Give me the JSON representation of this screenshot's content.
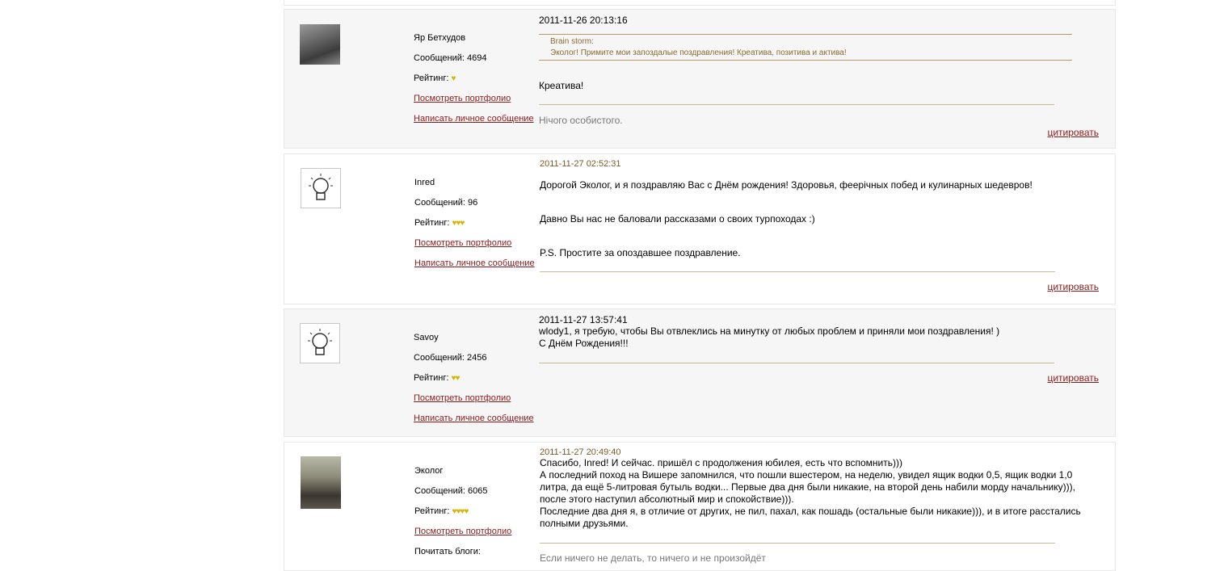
{
  "labels": {
    "messages_prefix": "Сообщений: ",
    "rating": "Рейтинг:",
    "portfolio_link": "Посмотреть портфолио",
    "pm_link": "Написать личное сообщение",
    "cite": "цитировать",
    "blogs": "Почитать блоги:"
  },
  "posts": [
    {
      "author": "Яр Бетхудов",
      "messages": "Сообщений: 4694",
      "rating_icons": "♥",
      "date": "2011-11-26 20:13:16",
      "quote_author": "Brain storm:",
      "quote_text": "Эколог! Примите мои запоздалые поздравления! Креатива, позитива и актива!",
      "body": [
        "Креатива!"
      ],
      "signature": "Нічого особистого."
    },
    {
      "author": "Inred",
      "messages": "Сообщений: 96",
      "rating_icons": "♥♥♥",
      "date": "2011-11-27 02:52:31",
      "body": [
        "Дорогой Эколог, и я поздравляю Вас с Днём рождения! Здоровья, феерічных побед и кулинарных шедевров!",
        "Давно Вы нас не баловали рассказами о своих турпоходах :)",
        "P.S. Простите за опоздавшее поздравление."
      ]
    },
    {
      "author": "Savoy",
      "messages": "Сообщений: 2456",
      "rating_icons": "♥♥",
      "date": "2011-11-27 13:57:41",
      "body": [
        "wlody1, я требую, чтобы Вы отвлеклись на минутку от любых проблем и приняли мои поздравления! )",
        "С Днём Рождения!!!"
      ]
    },
    {
      "author": "Эколог",
      "messages": "Сообщений: 6065",
      "rating_icons": "♥♥♥♥",
      "date": "2011-11-27 20:49:40",
      "body": [
        "Спасибо, Inred! И сейчас. пришёл с продолжения юбилея, есть что вспомнить)))",
        "А последний поход на Вишере запомнился, что пошли вшестером, на неделю, увидел ящик водки 0,5, ящик водки 1,0",
        "литра, да ещё 5-литровая бутыль водки... Первые два дня были никакие, на второй день набили морду начальнику))),",
        "после этого наступил абсолютный мир и спокойствие))).",
        "Последние два дня я, в отличие от других, не пил, пахал, как пошадь (остальные были никакие))), и в итоге расстались",
        "полными друзьями."
      ],
      "signature": "Если ничего не делать, то ничего и не произойдёт"
    }
  ],
  "colors": {
    "link": "#8b1a1a",
    "quote": "#8a6a35",
    "rating": "#d6b400"
  }
}
